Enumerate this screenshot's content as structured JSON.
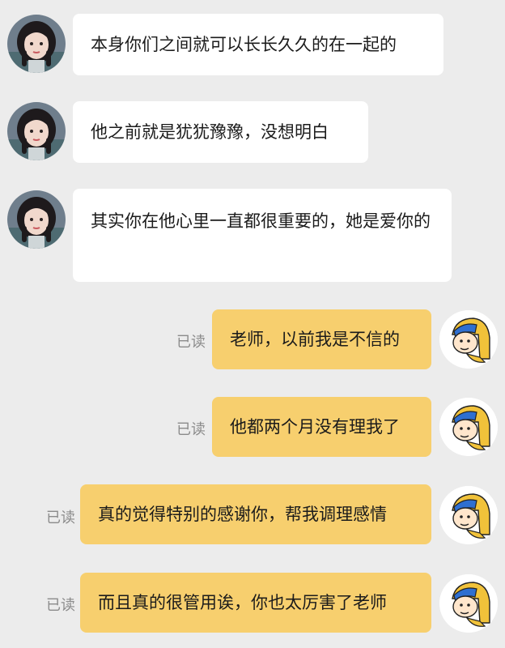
{
  "chat": {
    "messages": [
      {
        "side": "in",
        "text": "本身你们之间就可以长长久久的在一起的",
        "avatar": "girl-avatar"
      },
      {
        "side": "in",
        "text": "他之前就是犹犹豫豫，没想明白",
        "avatar": "girl-avatar"
      },
      {
        "side": "in",
        "text": "其实你在他心里一直都很重要的，她是爱你的",
        "avatar": "girl-avatar"
      },
      {
        "side": "out",
        "text": "老师，以前我是不信的",
        "read": "已读",
        "avatar": "cartoon-avatar"
      },
      {
        "side": "out",
        "text": "他都两个月没有理我了",
        "read": "已读",
        "avatar": "cartoon-avatar"
      },
      {
        "side": "out",
        "text": "真的觉得特别的感谢你，帮我调理感情",
        "read": "已读",
        "avatar": "cartoon-avatar"
      },
      {
        "side": "out",
        "text": "而且真的很管用诶，你也太厉害了老师",
        "read": "已读",
        "avatar": "cartoon-avatar"
      }
    ]
  },
  "colors": {
    "background": "#ececec",
    "incoming_bubble": "#ffffff",
    "outgoing_bubble": "#f7cf6e",
    "read_text": "#8b8b8b"
  }
}
